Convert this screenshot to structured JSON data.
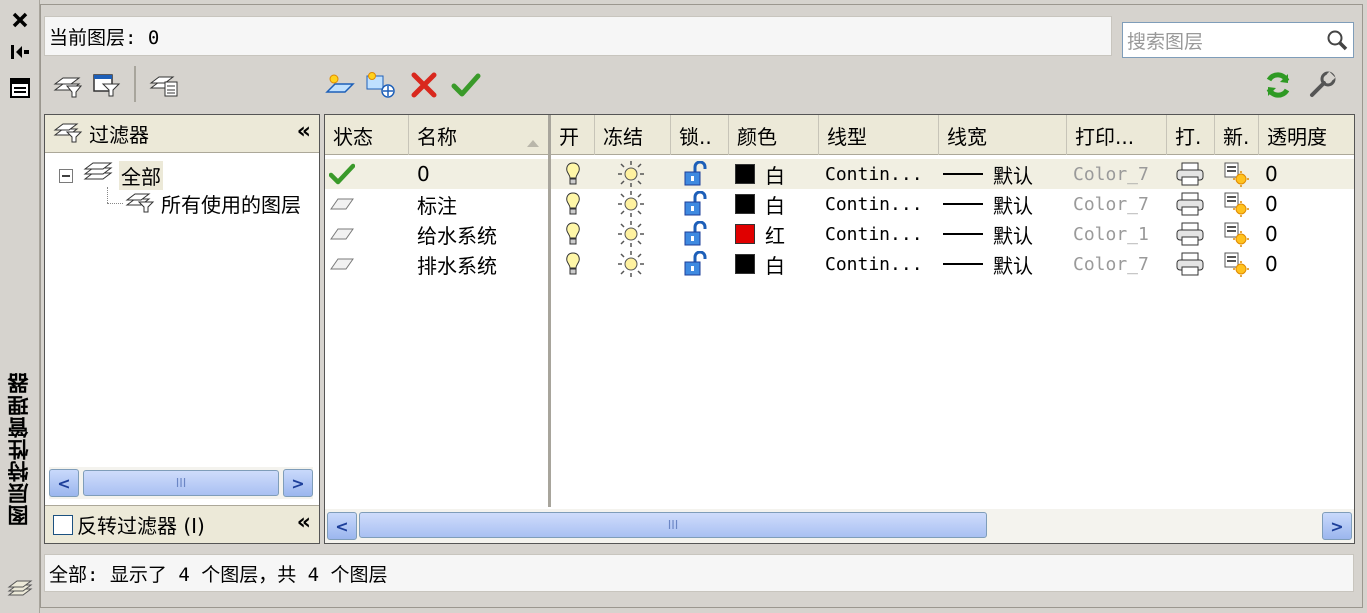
{
  "palette": {
    "accent": "#1d3f9a",
    "check": "#3a9a2a",
    "delete": "#d9281e",
    "red_swatch": "#e00000"
  },
  "window": {
    "title": "图层特性管理器"
  },
  "header": {
    "current_layer_label": "当前图层: 0",
    "search_placeholder": "搜索图层"
  },
  "filters": {
    "title": "过滤器",
    "tree": [
      {
        "label": "全部",
        "icon": "layer-stack-icon",
        "expanded": true
      },
      {
        "label": "所有使用的图层",
        "icon": "layer-filter-icon"
      }
    ],
    "invert_label": "反转过滤器 (I)"
  },
  "grid": {
    "columns": [
      "状态",
      "名称",
      "开",
      "冻结",
      "锁..",
      "颜色",
      "线型",
      "线宽",
      "打印...",
      "打.",
      "新.",
      "透明度"
    ],
    "rows": [
      {
        "status_icon": "current-check-icon",
        "name": "0",
        "color_name": "白",
        "color": "#000000",
        "linetype": "Contin...",
        "lineweight": "默认",
        "plot_style": "Color_7",
        "transparency": "0"
      },
      {
        "status_icon": "layer-icon",
        "name": "标注",
        "color_name": "白",
        "color": "#000000",
        "linetype": "Contin...",
        "lineweight": "默认",
        "plot_style": "Color_7",
        "transparency": "0"
      },
      {
        "status_icon": "layer-icon",
        "name": "给水系统",
        "color_name": "红",
        "color": "#e00000",
        "linetype": "Contin...",
        "lineweight": "默认",
        "plot_style": "Color_1",
        "transparency": "0"
      },
      {
        "status_icon": "layer-icon",
        "name": "排水系统",
        "color_name": "白",
        "color": "#000000",
        "linetype": "Contin...",
        "lineweight": "默认",
        "plot_style": "Color_7",
        "transparency": "0"
      }
    ]
  },
  "status": {
    "text": "全部: 显示了 4 个图层，共 4 个图层"
  }
}
